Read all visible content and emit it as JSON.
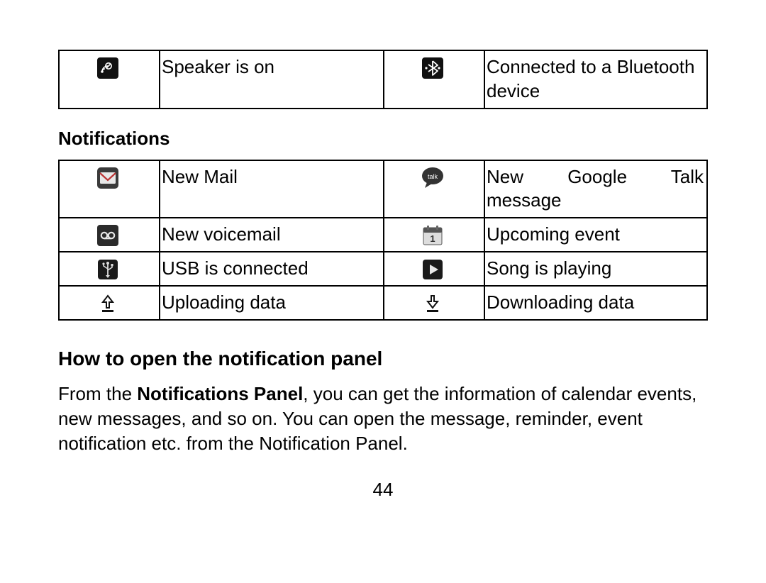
{
  "table1": {
    "rows": [
      {
        "iconL": "speaker-icon",
        "descL": "Speaker is on",
        "iconR": "bluetooth-connected-icon",
        "descR": "Connected to a Bluetooth device"
      }
    ]
  },
  "section_heading": "Notifications",
  "table2": {
    "rows": [
      {
        "iconL": "mail-icon",
        "descL": "New Mail",
        "iconR": "talk-icon",
        "descR_justify": "New Google Talk",
        "descR_line2": "message"
      },
      {
        "iconL": "voicemail-icon",
        "descL": "New voicemail",
        "iconR": "calendar-icon",
        "descR": "Upcoming event"
      },
      {
        "iconL": "usb-icon",
        "descL": "USB is connected",
        "iconR": "play-icon",
        "descR": "Song is playing"
      },
      {
        "iconL": "upload-icon",
        "descL": "Uploading data",
        "iconR": "download-icon",
        "descR": "Downloading data"
      }
    ]
  },
  "heading2": "How to open the notification panel",
  "para_parts": {
    "p1": "From the ",
    "bold": "Notifications Panel",
    "p2": ", you can get the information of calendar events, new messages, and so on. You can open the message, reminder, event notification etc. from the Notification Panel."
  },
  "page_number": "44"
}
